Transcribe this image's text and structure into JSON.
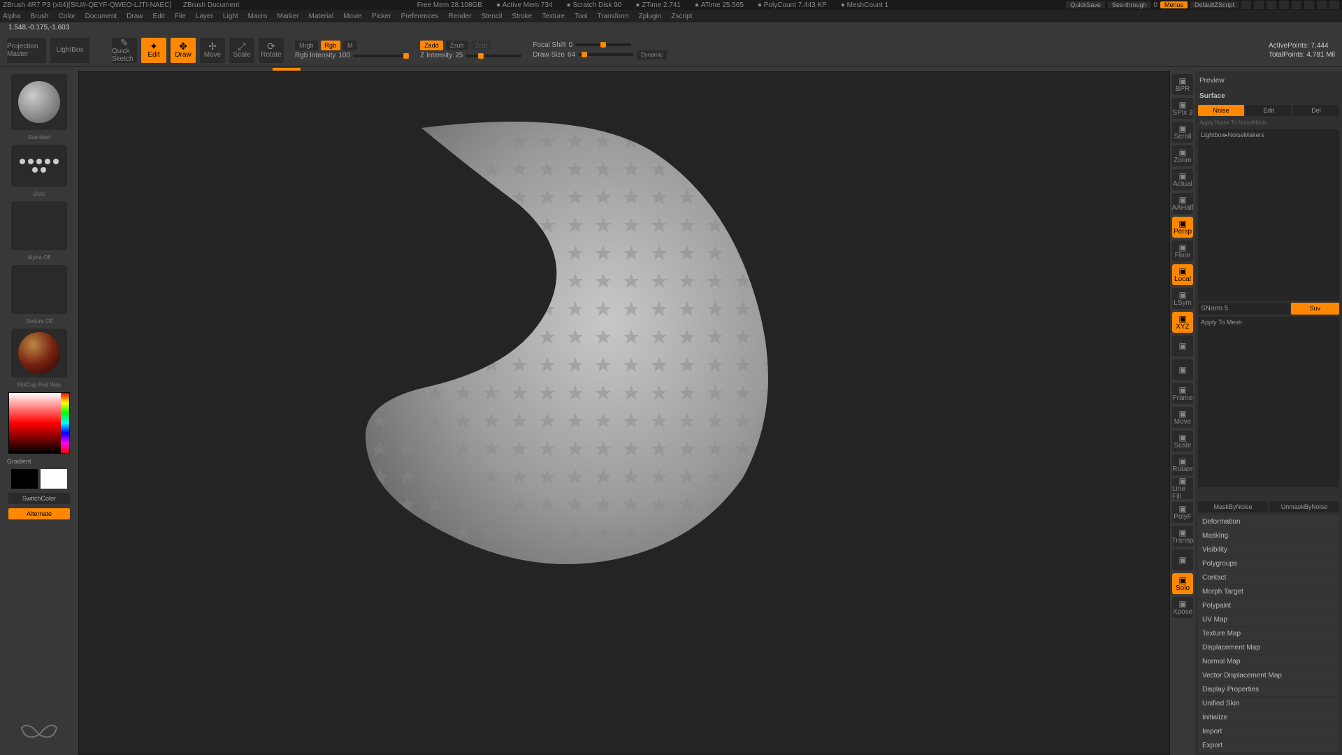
{
  "titlebar": {
    "app": "ZBrush 4R7 P3 (x64)[SIU#-QEYF-QWEO-LJTI-NAEC]",
    "doc": "ZBrush Document",
    "stats": [
      "Free Mem 28.108GB",
      "Active Mem 734",
      "Scratch Disk 90",
      "ZTime 2.741",
      "ATime 25.565",
      "PolyCount 7.443 KP",
      "MeshCount 1"
    ],
    "quicksave": "QuickSave",
    "seethrough": "See-through",
    "seethrough_val": "0",
    "menus": "Menus",
    "script": "DefaultZScript"
  },
  "menubar": [
    "Alpha",
    "Brush",
    "Color",
    "Document",
    "Draw",
    "Edit",
    "File",
    "Layer",
    "Light",
    "Macro",
    "Marker",
    "Material",
    "Movie",
    "Picker",
    "Preferences",
    "Render",
    "Stencil",
    "Stroke",
    "Texture",
    "Tool",
    "Transform",
    "Zplugin",
    "Zscript"
  ],
  "coord": "1.548,-0.175,-1.603",
  "toolbar": {
    "projection": "Projection Master",
    "lightbox": "LightBox",
    "quicksketch": "Quick Sketch",
    "edit": "Edit",
    "draw": "Draw",
    "move": "Move",
    "scale": "Scale",
    "rotate": "Rotate",
    "mrgb": "Mrgb",
    "rgb": "Rgb",
    "m": "M",
    "rgb_intensity_label": "Rgb Intensity",
    "rgb_intensity": "100",
    "zadd": "Zadd",
    "zsub": "Zsub",
    "zcut": "Zcut",
    "z_intensity_label": "Z Intensity",
    "z_intensity": "25",
    "focal_label": "Focal Shift",
    "focal": "0",
    "draw_size_label": "Draw Size",
    "draw_size": "64",
    "dynamic": "Dynamic",
    "active_points_label": "ActivePoints:",
    "active_points": "7,444",
    "total_points_label": "TotalPoints:",
    "total_points": "4.781 Mil"
  },
  "left": {
    "brush": "Standard",
    "stroke": "Dots",
    "alpha": "Alpha Off",
    "texture": "Texture Off",
    "material": "MatCap Red Wax",
    "gradient": "Gradient",
    "switchcolor": "SwitchColor",
    "alternate": "Alternate"
  },
  "right_tools": [
    "BPR",
    "SPix 3",
    "Scroll",
    "Zoom",
    "Actual",
    "AAHalf",
    "Persp",
    "Floor",
    "Local",
    "LSym",
    "XYZ",
    "",
    "",
    "Frame",
    "Move",
    "Scale",
    "Rotate",
    "Line Fill",
    "PolyF",
    "Transp",
    "",
    "Solo",
    "Xpose"
  ],
  "right_tools_active": {
    "Persp": true,
    "Local": true,
    "XYZ": true,
    "Solo": true
  },
  "surface": {
    "header": "Surface",
    "preview": "Preview",
    "noise": "Noise",
    "edit": "Edit",
    "del": "Del",
    "apply_noise": "Apply Noise To NoiseMesh",
    "lightbox": "Lightbox▸NoiseMakers",
    "snorm_label": "SNorm",
    "snorm": "5",
    "suv": "Suv",
    "apply_mesh": "Apply To Mesh",
    "mask_noise": "MaskByNoise",
    "unmask_noise": "UnmaskByNoise"
  },
  "sections": [
    "Deformation",
    "Masking",
    "Visibility",
    "Polygroups",
    "Contact",
    "Morph Target",
    "Polypaint",
    "UV Map",
    "Texture Map",
    "Displacement Map",
    "Normal Map",
    "Vector Displacement Map",
    "Display Properties",
    "Unified Skin",
    "Initialize",
    "Import",
    "Export"
  ]
}
